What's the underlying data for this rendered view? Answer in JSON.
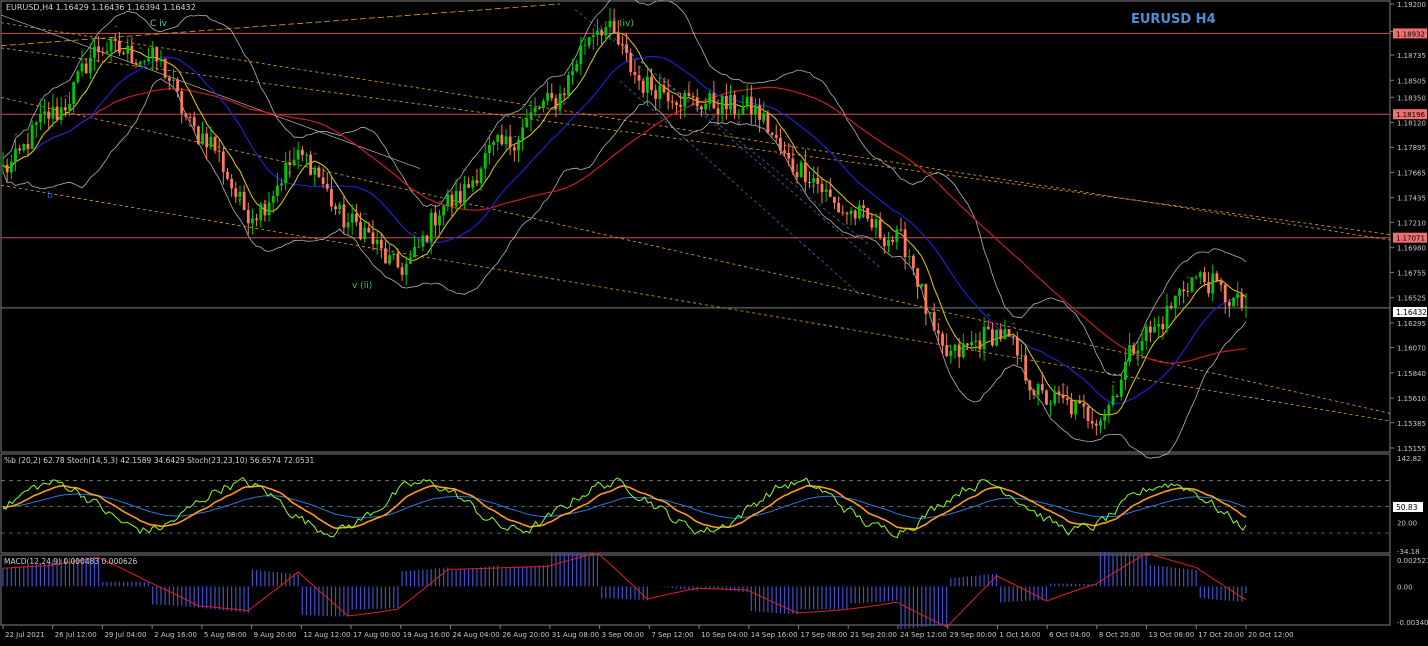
{
  "header": {
    "symbol_line": "EURUSD,H4  1.16429 1.16436 1.16394 1.16432",
    "watermark": "EURUSD H4"
  },
  "colors": {
    "background": "#000000",
    "bull_candle": "#00c800",
    "bear_candle": "#ff7a5a",
    "ma_red": "#c81e1e",
    "ma_blue": "#2020d0",
    "ma_yellow": "#e0d000",
    "bollinger": "#b4b4b4",
    "channel_orange": "#e8a020",
    "level_line": "#c85050",
    "stoch_green": "#8cff20",
    "stoch_orange": "#ff9a20",
    "stoch_blue": "#2a7ad8",
    "macd_hist": "#4050c8",
    "macd_signal": "#e02020",
    "watermark": "#4a90d8"
  },
  "labels": {
    "wave_c_iv": "C iv",
    "wave_iv_top": "(iv)",
    "wave_v_ii": "v (ii)",
    "wave_b": "b"
  },
  "price_axis": {
    "ticks": [
      "1.19200",
      "1.18950",
      "1.18735",
      "1.18505",
      "1.18350",
      "1.18120",
      "1.17895",
      "1.17665",
      "1.17435",
      "1.17210",
      "1.16980",
      "1.16755",
      "1.16525",
      "1.16295",
      "1.16070",
      "1.15840",
      "1.15610",
      "1.15385",
      "1.15155"
    ],
    "level_labels": [
      "1.18932",
      "1.18196",
      "1.17071"
    ],
    "current_price": "1.16432",
    "ylim": [
      1.15155,
      1.192
    ]
  },
  "time_axis": {
    "labels": [
      "22 Jul 2021",
      "26 Jul 12:00",
      "29 Jul 04:00",
      "2 Aug 16:00",
      "5 Aug 08:00",
      "9 Aug 20:00",
      "12 Aug 12:00",
      "17 Aug 00:00",
      "19 Aug 16:00",
      "24 Aug 04:00",
      "26 Aug 20:00",
      "31 Aug 08:00",
      "3 Sep 00:00",
      "7 Sep 12:00",
      "10 Sep 04:00",
      "14 Sep 16:00",
      "17 Sep 08:00",
      "21 Sep 20:00",
      "24 Sep 12:00",
      "29 Sep 00:00",
      "1 Oct 16:00",
      "6 Oct 04:00",
      "8 Oct 20:00",
      "13 Oct 08:00",
      "17 Oct 20:00",
      "20 Oct 12:00"
    ]
  },
  "stoch_panel": {
    "header": "%b (20,2) 62.78  Stoch(14,5,3) 42.1589 34.6429  Stoch(23,23,10) 56.6574 72.0531",
    "ticks": [
      "142.82",
      "50.83",
      "20.00",
      "-34.18"
    ],
    "current_value": "50.83"
  },
  "macd_panel": {
    "header": "MACD(12,24,9) 0.000483 0.000626",
    "ticks": [
      "0.002527",
      "0.00",
      "-0.003406"
    ]
  },
  "chart_data": {
    "type": "line",
    "title": "EURUSD H4",
    "symbol": "EURUSD",
    "timeframe": "H4",
    "last_ohlc": {
      "open": 1.16429,
      "high": 1.16436,
      "low": 1.16394,
      "close": 1.16432
    },
    "horizontal_levels": [
      1.18932,
      1.18196,
      1.17071
    ],
    "x": [
      "22 Jul 2021",
      "26 Jul 12:00",
      "29 Jul 04:00",
      "2 Aug 16:00",
      "5 Aug 08:00",
      "9 Aug 20:00",
      "12 Aug 12:00",
      "17 Aug 00:00",
      "19 Aug 16:00",
      "24 Aug 04:00",
      "26 Aug 20:00",
      "31 Aug 08:00",
      "3 Sep 00:00",
      "7 Sep 12:00",
      "10 Sep 04:00",
      "14 Sep 16:00",
      "17 Sep 08:00",
      "21 Sep 20:00",
      "24 Sep 12:00",
      "29 Sep 00:00",
      "1 Oct 16:00",
      "6 Oct 04:00",
      "8 Oct 20:00",
      "13 Oct 08:00",
      "17 Oct 20:00",
      "20 Oct 12:00"
    ],
    "series": [
      {
        "values": [
          1.177,
          1.182,
          1.188,
          1.187,
          1.18,
          1.173,
          1.178,
          1.172,
          1.168,
          1.174,
          1.179,
          1.183,
          1.19,
          1.1845,
          1.183,
          1.1825,
          1.177,
          1.173,
          1.1705,
          1.16,
          1.162,
          1.156,
          1.1545,
          1.162,
          1.167,
          1.1645
        ]
      }
    ],
    "ylim": [
      1.15155,
      1.192
    ],
    "grid": false
  }
}
